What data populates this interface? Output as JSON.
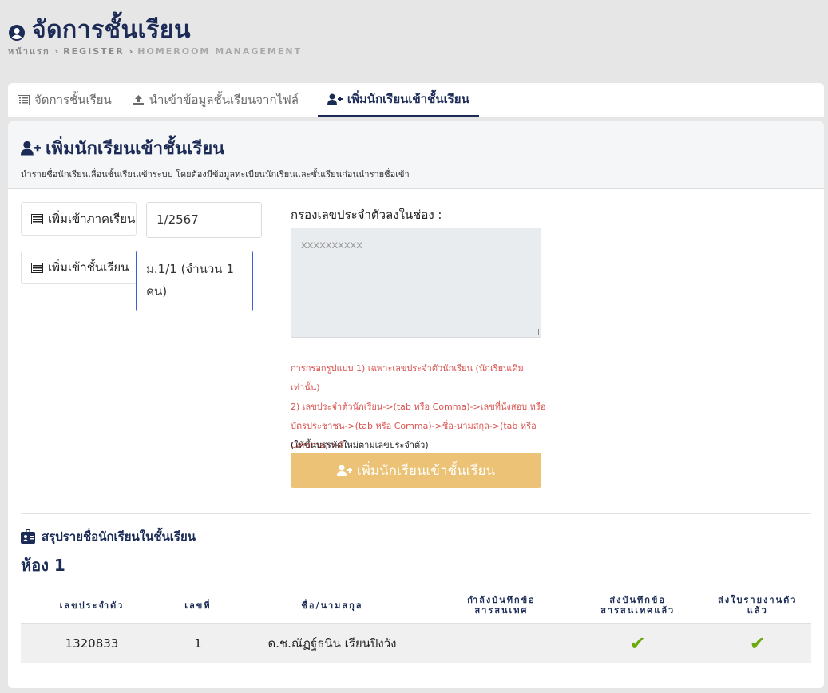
{
  "page": {
    "title": "จัดการชั้นเรียน",
    "breadcrumb": [
      "หน้าแรก",
      "REGISTER",
      "HOMEROOM MANAGEMENT"
    ]
  },
  "tabs": [
    {
      "label": "จัดการชั้นเรียน",
      "icon": "list-icon",
      "active": false
    },
    {
      "label": "นำเข้าข้อมูลชั้นเรียนจากไฟล์",
      "icon": "upload-icon",
      "active": false
    },
    {
      "label": "เพิ่มนักเรียนเข้าชั้นเรียน",
      "icon": "user-plus-icon",
      "active": true
    }
  ],
  "card": {
    "title": "เพิ่มนักเรียนเข้าชั้นเรียน",
    "subtitle": "นำรายชื่อนักเรียนเลื่อนชั้นเรียนเข้าระบบ โดยต้องมีข้อมูลทะเบียนนักเรียนและชั้นเรียนก่อนนำรายชื่อเข้า"
  },
  "form": {
    "term_label": "เพิ่มเข้าภาคเรียน",
    "term_value": "1/2567",
    "class_label": "เพิ่มเข้าชั้นเรียน",
    "class_value": "ม.1/1 (จำนวน 1 คน)",
    "filter_label": "กรองเลขประจำตัวลงในช่อง :",
    "filter_placeholder": "xxxxxxxxxx",
    "hint_line1": "การกรอกรูปแบบ 1) เฉพาะเลขประจำตัวนักเรียน (นักเรียนเดิมเท่านั้น)",
    "hint_line2": "2) เลขประจำตัวนักเรียน->(tab หรือ Comma)->เลขที่นั่งสอบ หรือ",
    "hint_line3": "บัตรประชาชน->(tab หรือ Comma)->ชื่อ-นามสกุล->(tab หรือ",
    "hint_line4": "Comma)->สี",
    "hint_note": "(ให้ขึ้นบรรทัดใหม่ตามเลขประจำตัว)",
    "submit_label": "เพิ่มนักเรียนเข้าชั้นเรียน"
  },
  "summary": {
    "title": "สรุปรายชื่อนักเรียนในชั้นเรียน",
    "room": "ห้อง 1",
    "columns": [
      "เลขประจำตัว",
      "เลขที่",
      "ชื่อ/นามสกุล",
      "กำลังบันทึกข้อสารสนเทศ",
      "ส่งบันทึกข้อสารสนเทศแล้ว",
      "ส่งใบรายงานตัวแล้ว"
    ],
    "rows": [
      {
        "student_id": "1320833",
        "number": "1",
        "name": "ด.ช.ณัฏฐ์ธนิน เรียนปิงวัง",
        "saving": "",
        "sent_info": "✔",
        "sent_report": "✔"
      }
    ]
  },
  "colors": {
    "primary": "#1b2b56",
    "button": "#ecc376",
    "hint": "#d9534f",
    "check": "#6aa90f"
  }
}
